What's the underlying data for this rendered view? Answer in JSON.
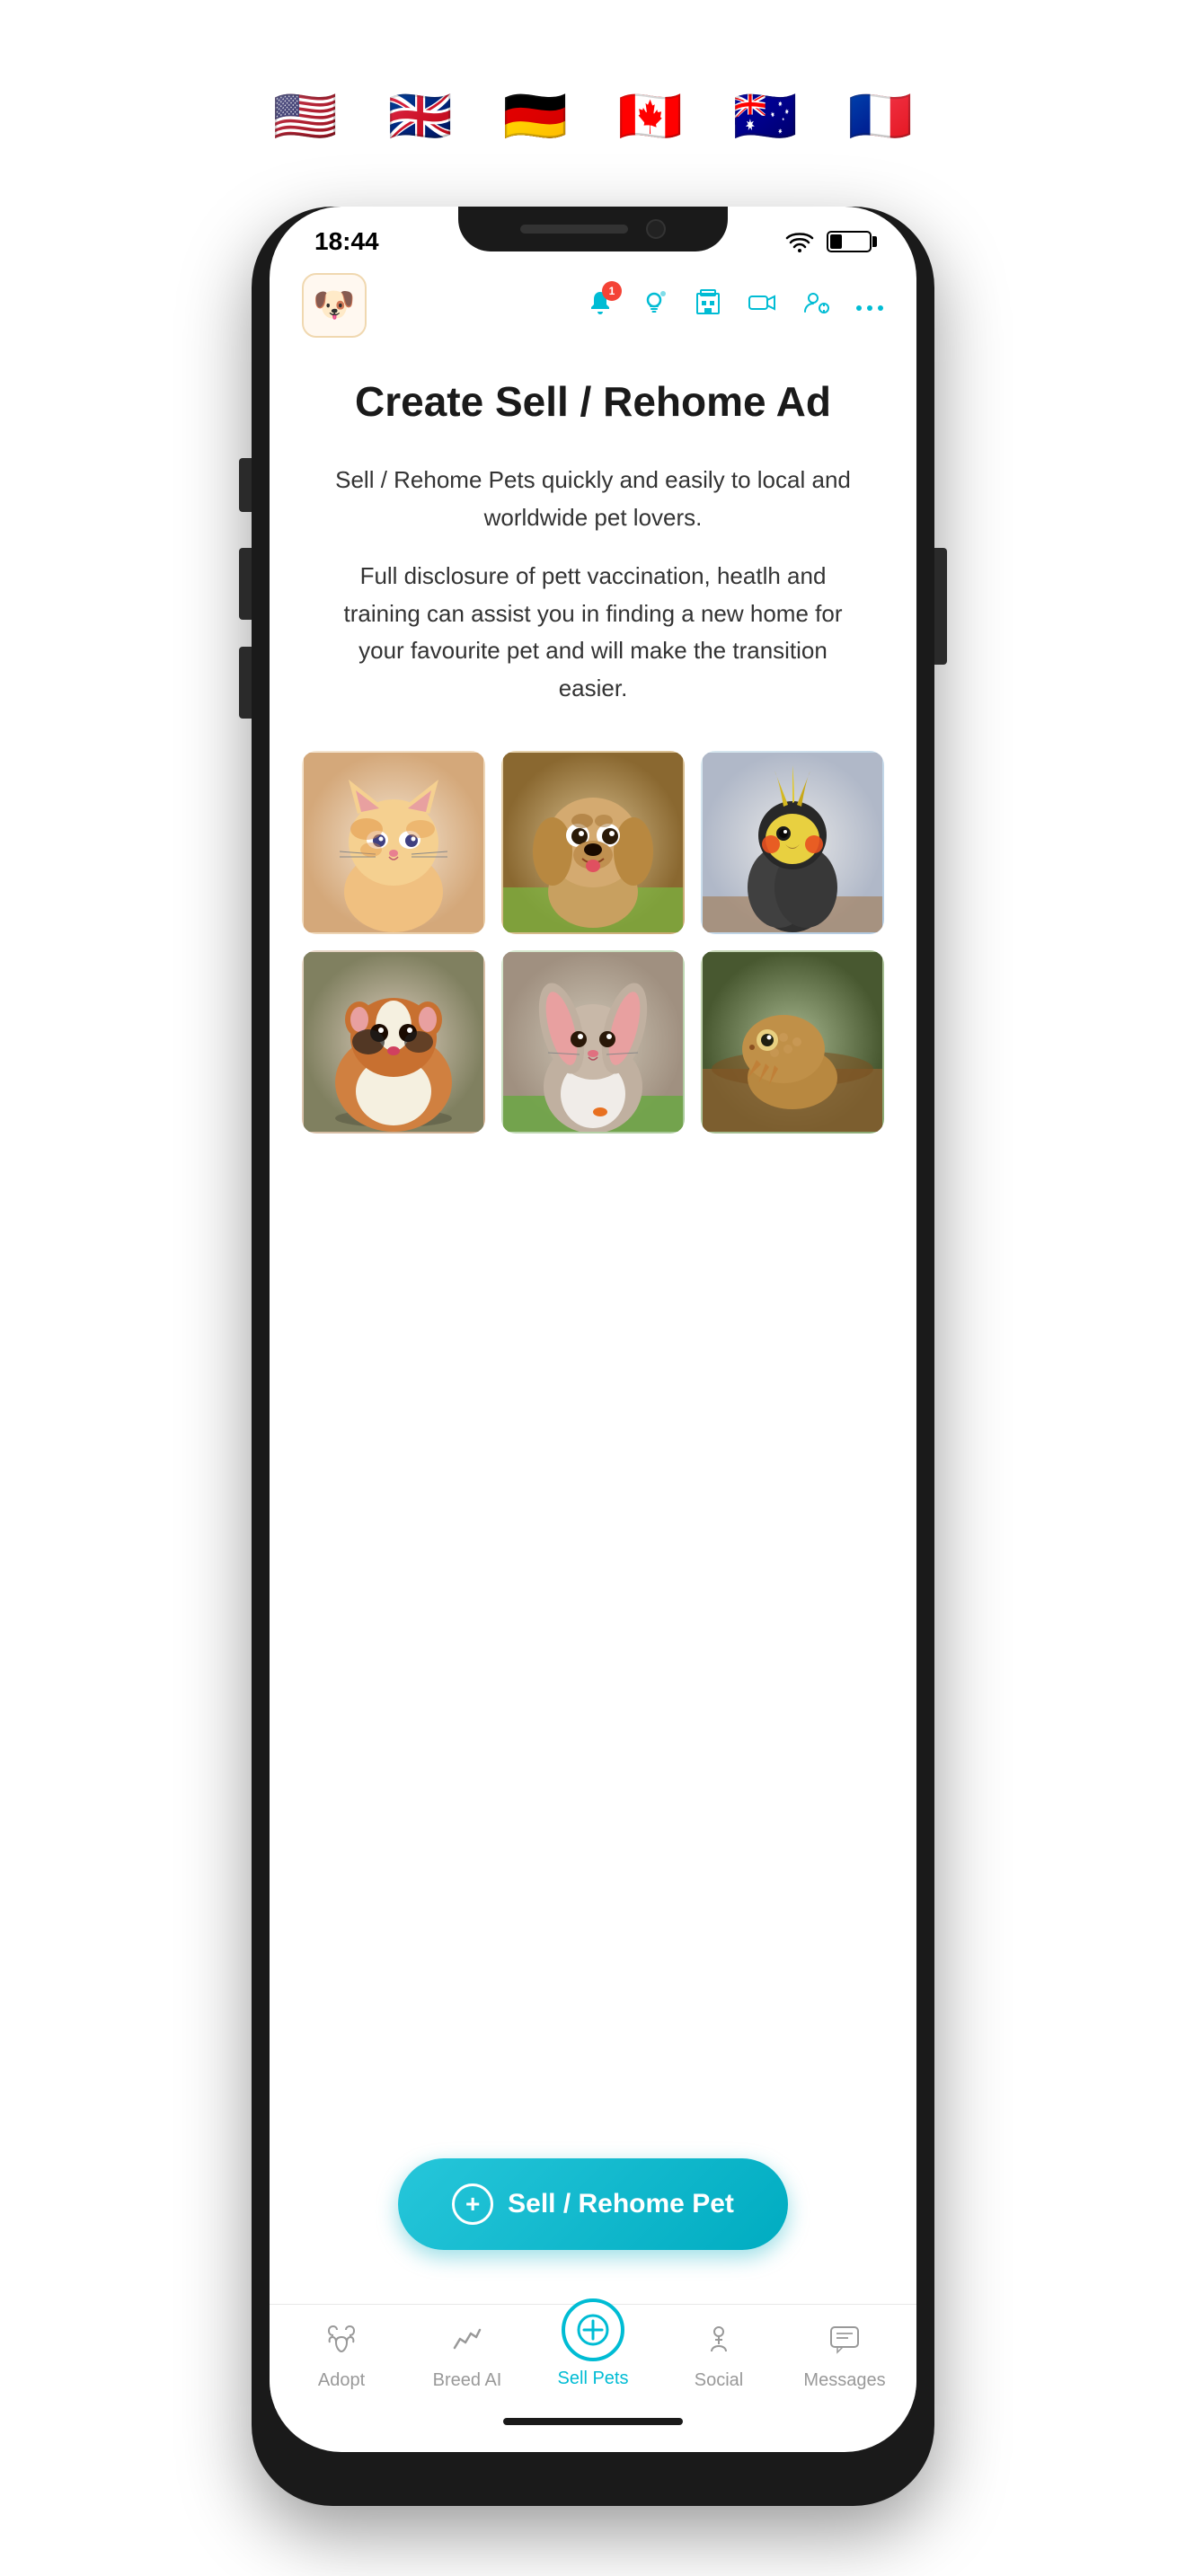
{
  "flags": {
    "items": [
      {
        "name": "usa-flag",
        "emoji": "🇺🇸"
      },
      {
        "name": "uk-flag",
        "emoji": "🇬🇧"
      },
      {
        "name": "germany-flag",
        "emoji": "🇩🇪"
      },
      {
        "name": "canada-flag",
        "emoji": "🇨🇦"
      },
      {
        "name": "australia-flag",
        "emoji": "🇦🇺"
      },
      {
        "name": "france-flag",
        "emoji": "🇫🇷"
      }
    ]
  },
  "status_bar": {
    "time": "18:44"
  },
  "top_nav": {
    "logo_emoji": "🐶",
    "notification_count": "1",
    "icons": [
      "🔔",
      "💡",
      "🏢",
      "📹",
      "👤",
      "···"
    ]
  },
  "page": {
    "title": "Create Sell / Rehome Ad",
    "description_1": "Sell / Rehome Pets quickly and easily to local and worldwide pet lovers.",
    "description_2": "Full disclosure of pett vaccination, heatlh and training can assist you in finding a new home for your favourite pet and will make the transition easier."
  },
  "pets": [
    {
      "name": "kitten",
      "emoji": "🐱",
      "bg_start": "#f5e6d3",
      "bg_end": "#e8c9a0"
    },
    {
      "name": "puppy",
      "emoji": "🐶",
      "bg_start": "#e8d5b0",
      "bg_end": "#c9a870"
    },
    {
      "name": "cockatiel",
      "emoji": "🦜",
      "bg_start": "#d8e8f0",
      "bg_end": "#b0c8e0"
    },
    {
      "name": "guinea-pig",
      "emoji": "🐹",
      "bg_start": "#e8d8c8",
      "bg_end": "#c8a888"
    },
    {
      "name": "rabbit",
      "emoji": "🐰",
      "bg_start": "#d8e8d0",
      "bg_end": "#a8c898"
    },
    {
      "name": "lizard",
      "emoji": "🦎",
      "bg_start": "#c8d8b8",
      "bg_end": "#88a870"
    }
  ],
  "sell_button": {
    "label": "Sell / Rehome Pet",
    "plus_symbol": "+"
  },
  "bottom_nav": {
    "items": [
      {
        "id": "adopt",
        "label": "Adopt",
        "icon": "🐾",
        "active": false
      },
      {
        "id": "breed-ai",
        "label": "Breed AI",
        "icon": "📈",
        "active": false
      },
      {
        "id": "sell-pets",
        "label": "Sell Pets",
        "icon": "+",
        "active": true
      },
      {
        "id": "social",
        "label": "Social",
        "icon": "🚶",
        "active": false
      },
      {
        "id": "messages",
        "label": "Messages",
        "icon": "💬",
        "active": false
      }
    ]
  }
}
